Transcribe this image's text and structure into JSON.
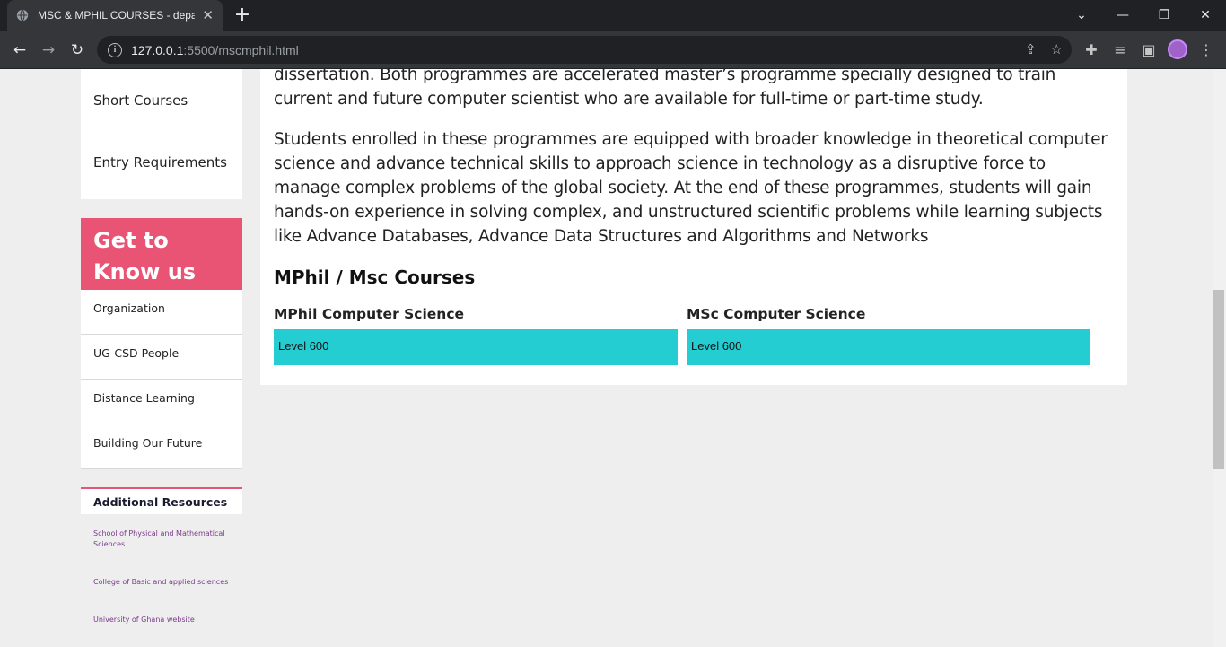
{
  "browser": {
    "tab_title": "MSC & MPHIL COURSES - depar",
    "tab_close": "✕",
    "new_tab": "+",
    "url_host": "127.0.0.1",
    "url_path": ":5500/mscmphil.html"
  },
  "sidebar": {
    "menu_items": [
      {
        "label": "Short Courses"
      },
      {
        "label": "Entry Requirements"
      }
    ],
    "get_to_know": {
      "heading": "Get to Know us",
      "items": [
        {
          "label": "Organization"
        },
        {
          "label": "UG-CSD People"
        },
        {
          "label": "Distance Learning"
        },
        {
          "label": "Building Our Future"
        }
      ]
    },
    "resources": {
      "heading": "Additional Resources",
      "links": [
        {
          "label": "School of Physical and Mathematical Sciences"
        },
        {
          "label": "College of Basic and applied sciences"
        },
        {
          "label": "University of Ghana website"
        }
      ]
    }
  },
  "main": {
    "intro_tail": "dissertation. Both programmes are accelerated master’s programme specially designed to train current and future computer scientist who are available for full-time or part-time study.",
    "paragraph2": "Students enrolled in these programmes are equipped with broader knowledge in theoretical computer science and advance technical skills to approach science in technology as a disruptive force to manage complex problems of the global society. At the end of these programmes, students will gain hands-on experience in solving complex, and unstructured scientific problems while learning subjects like Advance Databases, Advance Data Structures and Algorithms and Networks",
    "section_title": "MPhil / Msc Courses",
    "courses": [
      {
        "name": "MPhil Computer Science",
        "level": "Level 600"
      },
      {
        "name": "MSc Computer Science",
        "level": "Level 600"
      }
    ]
  },
  "colors": {
    "accent_pink": "#ea5474",
    "level_bar": "#24cdd1"
  }
}
